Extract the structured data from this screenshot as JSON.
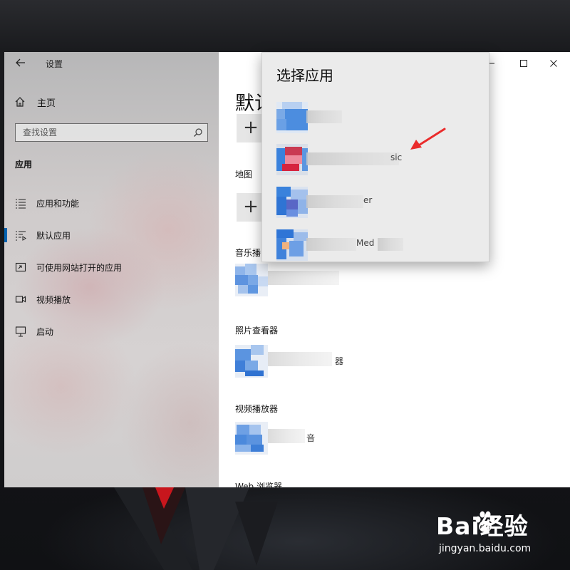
{
  "window": {
    "title": "设置",
    "accent_color": "#0063b1"
  },
  "sidebar": {
    "home_label": "主页",
    "search_placeholder": "查找设置",
    "section_label": "应用",
    "selected_index": 1,
    "items": [
      {
        "label": "应用和功能",
        "icon": "apps-features-icon"
      },
      {
        "label": "默认应用",
        "icon": "default-apps-icon"
      },
      {
        "label": "可使用网站打开的应用",
        "icon": "apps-for-websites-icon"
      },
      {
        "label": "视频播放",
        "icon": "video-playback-icon"
      },
      {
        "label": "启动",
        "icon": "startup-icon"
      }
    ]
  },
  "main": {
    "page_title": "默认",
    "plus_symbol": "+",
    "categories": [
      {
        "label": "地图"
      },
      {
        "label": "音乐播"
      },
      {
        "label": "照片查看器",
        "app_name": "器"
      },
      {
        "label": "视频播放器",
        "app_name": "音"
      },
      {
        "label": "Web 浏览器"
      }
    ]
  },
  "flyout": {
    "title": "选择应用",
    "items": [
      {
        "name": ""
      },
      {
        "name": "sic"
      },
      {
        "name": "er"
      },
      {
        "name": "Med"
      }
    ]
  },
  "watermark": {
    "brand": "Bai经验",
    "url": "jingyan.baidu.com"
  }
}
